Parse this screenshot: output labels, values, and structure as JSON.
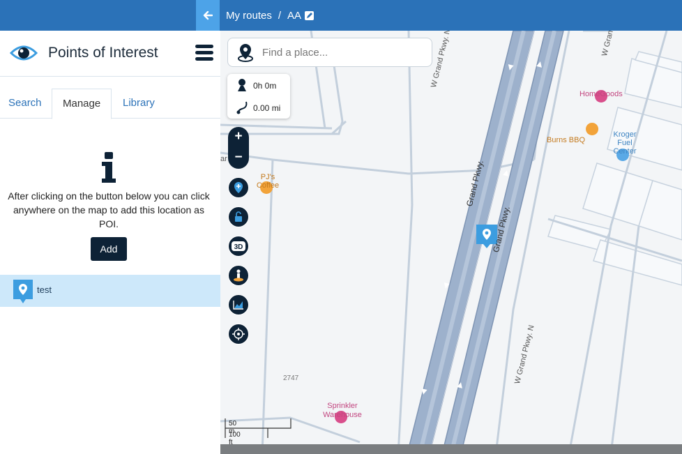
{
  "header": {
    "breadcrumb_root": "My routes",
    "breadcrumb_sep": "/",
    "route_name": "AA"
  },
  "sidebar": {
    "title": "Points of Interest",
    "tabs": [
      {
        "label": "Search"
      },
      {
        "label": "Manage"
      },
      {
        "label": "Library"
      }
    ],
    "active_tab": "Manage",
    "help_text": "After clicking on the button below you can click anywhere on the map to add this location as POI.",
    "add_button": "Add",
    "pois": [
      {
        "name": "test"
      }
    ]
  },
  "map": {
    "search_placeholder": "Find a place...",
    "duration": "0h 0m",
    "distance": "0.00 mi",
    "zoom_in": "+",
    "zoom_out": "−",
    "labels": {
      "wgrand_top": "W Grand Pkwy. N",
      "wgrand_top2": "W Gran",
      "grand_pkwy_1": "Grand Pkwy.",
      "grand_pkwy_2": "Grand Pkwy.",
      "wgrand_right": "W Grand Pkwy. N",
      "homegoods": "HomeGoods",
      "burns": "Burns BBQ",
      "kroger_1": "Kroger",
      "kroger_2": "Fuel",
      "kroger_3": "Center",
      "pjs_1": "PJ's",
      "pjs_2": "Coffee",
      "sprinkler_1": "Sprinkler",
      "sprinkler_2": "Warehouse",
      "number": "2747",
      "partial": "ar"
    },
    "scale_m": "50 m",
    "scale_ft": "100 ft"
  },
  "colors": {
    "topbar": "#2b72b8",
    "dark_navy": "#0d2236",
    "selected_row": "#cde8fa",
    "highway": "#9db1cc",
    "poi_pink": "#d94f8c",
    "poi_orange": "#f2a33a",
    "poi_blue": "#5aa9e6"
  }
}
